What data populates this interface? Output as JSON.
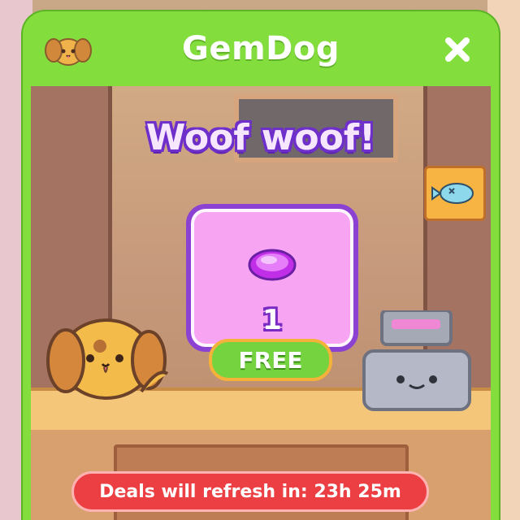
{
  "header": {
    "title": "GemDog",
    "close_icon": "close-icon",
    "dog_icon": "dog-icon"
  },
  "main": {
    "heading": "Woof woof!",
    "offer": {
      "item_icon": "gem-icon",
      "quantity": "1",
      "button_label": "FREE"
    }
  },
  "footer": {
    "refresh_text": "Deals will refresh in: 23h 25m"
  },
  "colors": {
    "header_green": "#83de3d",
    "offer_purple": "#8b42d3",
    "offer_pink": "#f7a4f2",
    "free_green": "#75d340",
    "refresh_red": "#ec3f43"
  }
}
